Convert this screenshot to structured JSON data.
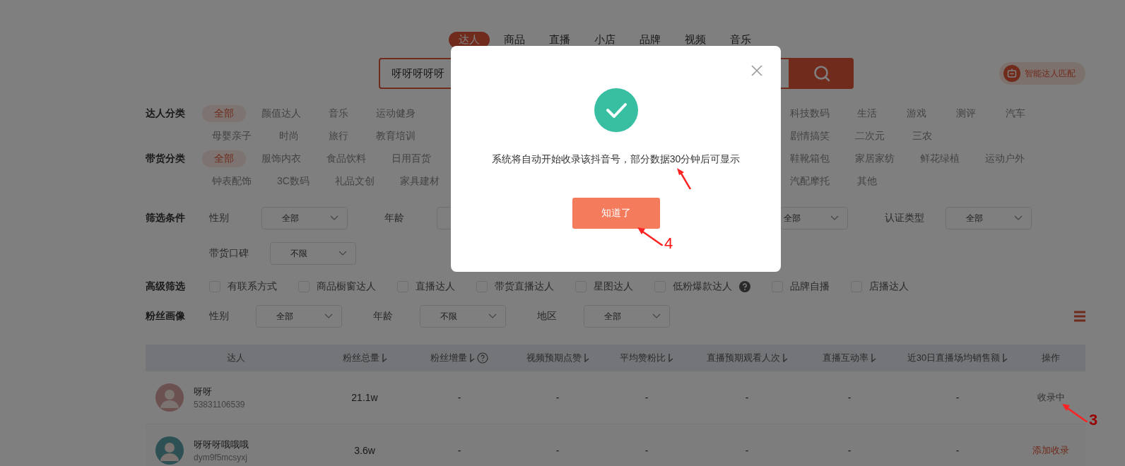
{
  "tabs": [
    {
      "label": "达人",
      "selected": true
    },
    {
      "label": "商品",
      "selected": false
    },
    {
      "label": "直播",
      "selected": false
    },
    {
      "label": "小店",
      "selected": false
    },
    {
      "label": "品牌",
      "selected": false
    },
    {
      "label": "视频",
      "selected": false
    },
    {
      "label": "音乐",
      "selected": false
    }
  ],
  "search": {
    "value": "呀呀呀呀呀"
  },
  "smart_match": {
    "label": "智能达人匹配"
  },
  "categories": [
    {
      "label": "达人分类",
      "lines": [
        {
          "left": [
            {
              "label": "全部",
              "selected": true
            },
            {
              "label": "颜值达人",
              "selected": false
            },
            {
              "label": "音乐",
              "selected": false
            },
            {
              "label": "运动健身",
              "selected": false
            }
          ],
          "right": [
            {
              "label": "科技数码",
              "selected": false
            },
            {
              "label": "生活",
              "selected": false
            },
            {
              "label": "游戏",
              "selected": false
            },
            {
              "label": "测评",
              "selected": false
            },
            {
              "label": "汽车",
              "selected": false
            }
          ]
        },
        {
          "left": [
            {
              "label": "母婴亲子",
              "selected": false
            },
            {
              "label": "时尚",
              "selected": false
            },
            {
              "label": "旅行",
              "selected": false
            },
            {
              "label": "教育培训",
              "selected": false
            }
          ],
          "right": [
            {
              "label": "剧情搞笑",
              "selected": false
            },
            {
              "label": "二次元",
              "selected": false
            },
            {
              "label": "三农",
              "selected": false
            }
          ]
        }
      ]
    },
    {
      "label": "带货分类",
      "lines": [
        {
          "left": [
            {
              "label": "全部",
              "selected": true
            },
            {
              "label": "服饰内衣",
              "selected": false
            },
            {
              "label": "食品饮料",
              "selected": false
            },
            {
              "label": "日用百货",
              "selected": false
            }
          ],
          "right": [
            {
              "label": "鞋靴箱包",
              "selected": false
            },
            {
              "label": "家居家纺",
              "selected": false
            },
            {
              "label": "鲜花绿植",
              "selected": false
            },
            {
              "label": "运动户外",
              "selected": false
            }
          ]
        },
        {
          "left": [
            {
              "label": "钟表配饰",
              "selected": false
            },
            {
              "label": "3C数码",
              "selected": false
            },
            {
              "label": "礼品文创",
              "selected": false
            },
            {
              "label": "家具建材",
              "selected": false
            }
          ],
          "right": [
            {
              "label": "汽配摩托",
              "selected": false
            },
            {
              "label": "其他",
              "selected": false
            }
          ]
        }
      ]
    }
  ],
  "filters": {
    "label": "筛选条件",
    "lines": [
      {
        "left": [
          {
            "label": "性别",
            "value": "全部"
          },
          {
            "label": "年龄"
          }
        ],
        "right": [
          {
            "value": "全部"
          },
          {
            "label": "认证类型",
            "value": "全部"
          }
        ]
      },
      {
        "left": [
          {
            "label": "带货口碑",
            "value": "不限"
          }
        ]
      }
    ]
  },
  "advanced": {
    "label": "高级筛选",
    "options": [
      {
        "label": "有联系方式",
        "checked": false
      },
      {
        "label": "商品橱窗达人",
        "checked": false
      },
      {
        "label": "直播达人",
        "checked": false
      },
      {
        "label": "带货直播达人",
        "checked": false
      },
      {
        "label": "星图达人",
        "checked": false
      },
      {
        "label": "低粉爆款达人",
        "checked": false,
        "help": true
      },
      {
        "label": "品牌自播",
        "checked": false
      },
      {
        "label": "店播达人",
        "checked": false
      }
    ]
  },
  "fans": {
    "label": "粉丝画像",
    "fields": [
      {
        "label": "性别",
        "value": "全部"
      },
      {
        "label": "年龄",
        "value": "不限"
      },
      {
        "label": "地区",
        "value": "全部"
      }
    ]
  },
  "table": {
    "columns": [
      {
        "label": "达人"
      },
      {
        "label": "粉丝总量",
        "sortable": true
      },
      {
        "label": "粉丝增量",
        "sortable": true,
        "help": true
      },
      {
        "label": "视频预期点赞",
        "sortable": true
      },
      {
        "label": "平均赞粉比",
        "sortable": true
      },
      {
        "label": "直播预期观看人次",
        "sortable": true
      },
      {
        "label": "直播互动率",
        "sortable": true
      },
      {
        "label": "近30日直播场均销售额",
        "sortable": true
      },
      {
        "label": "操作"
      }
    ],
    "rows": [
      {
        "cells": [
          {
            "kind": "influencer",
            "name": "呀呀",
            "id": "53831106539"
          },
          {
            "kind": "text",
            "value": "21.1w"
          },
          {
            "kind": "text",
            "value": "-"
          },
          {
            "kind": "text",
            "value": "-"
          },
          {
            "kind": "text",
            "value": "-"
          },
          {
            "kind": "text",
            "value": "-"
          },
          {
            "kind": "text",
            "value": "-"
          },
          {
            "kind": "text",
            "value": "-"
          },
          {
            "kind": "status",
            "value": "收录中"
          }
        ]
      },
      {
        "cells": [
          {
            "kind": "influencer",
            "name": "呀呀呀哦哦哦",
            "id": "dym9f5mcsyxj"
          },
          {
            "kind": "text",
            "value": "3.6w"
          },
          {
            "kind": "text",
            "value": "-"
          },
          {
            "kind": "text",
            "value": "-"
          },
          {
            "kind": "text",
            "value": "-"
          },
          {
            "kind": "text",
            "value": "-"
          },
          {
            "kind": "text",
            "value": "-"
          },
          {
            "kind": "text",
            "value": "-"
          },
          {
            "kind": "link",
            "value": "添加收录"
          }
        ]
      }
    ]
  },
  "dialog": {
    "message": "系统将自动开始收录该抖音号，部分数据30分钟后可显示",
    "button": "知道了"
  },
  "annotations": [
    {
      "kind": "arrow"
    },
    {
      "kind": "numbered",
      "number": "4"
    },
    {
      "kind": "numbered",
      "number": "3"
    }
  ]
}
